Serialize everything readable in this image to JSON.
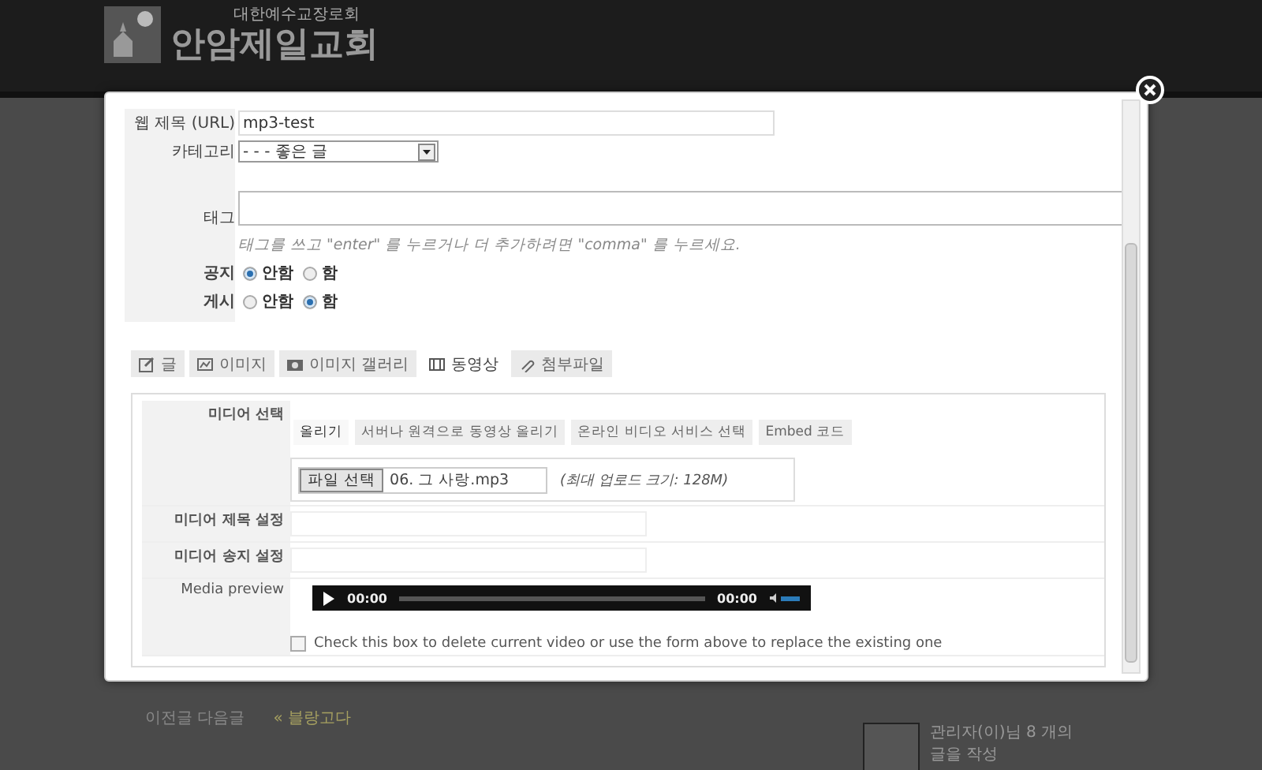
{
  "header": {
    "subtitle": "대한예수교장로회",
    "title": "안암제일교회"
  },
  "background": {
    "nav_links": [
      "이전글 다음글",
      "« 블랑고다"
    ],
    "widget_text": [
      "관리자(이)님 8 개의",
      "글을 작성"
    ]
  },
  "dialog": {
    "fields": [
      {
        "kind": "text",
        "label": "웹 제목 (URL)",
        "value": "mp3-test"
      },
      {
        "kind": "select",
        "label": "카테고리",
        "value": "- - - 좋은 글"
      },
      {
        "kind": "tags",
        "label": "태그",
        "hint": "태그를 쓰고 \"enter\" 를 누르거나 더 추가하려면 \"comma\" 를 누르세요."
      },
      {
        "kind": "radio",
        "label": "공지",
        "options": [
          {
            "label": "안함",
            "selected": true
          },
          {
            "label": "함",
            "selected": false
          }
        ]
      },
      {
        "kind": "radio",
        "label": "게시",
        "options": [
          {
            "label": "안함",
            "selected": false
          },
          {
            "label": "함",
            "selected": true
          }
        ]
      }
    ],
    "tabs": [
      {
        "label": "글",
        "selected": false
      },
      {
        "label": "이미지",
        "selected": false
      },
      {
        "label": "이미지 갤러리",
        "selected": false
      },
      {
        "label": "동영상",
        "selected": true
      },
      {
        "label": "첨부파일",
        "selected": false
      }
    ],
    "media": {
      "select_label": "미디어 선택",
      "subtabs": [
        {
          "label": "올리기",
          "selected": true
        },
        {
          "label": "서버나 원격으로 동영상 올리기",
          "selected": false
        },
        {
          "label": "온라인 비디오 서비스 선택",
          "selected": false
        },
        {
          "label": "Embed 코드",
          "selected": false
        }
      ],
      "file_button": "파일 선택",
      "file_name": "06. 그 사랑.mp3",
      "max_size": "(최대 업로드 크기: 128M)",
      "title_label": "미디어 제목 설정",
      "cover_label": "미디어 송지 설정",
      "preview_label": "Media preview",
      "player": {
        "current": "00:00",
        "duration": "00:00"
      },
      "delete_checkbox": {
        "label": "Check this box to delete current video or use the form above to replace the existing one",
        "checked": false
      }
    }
  }
}
